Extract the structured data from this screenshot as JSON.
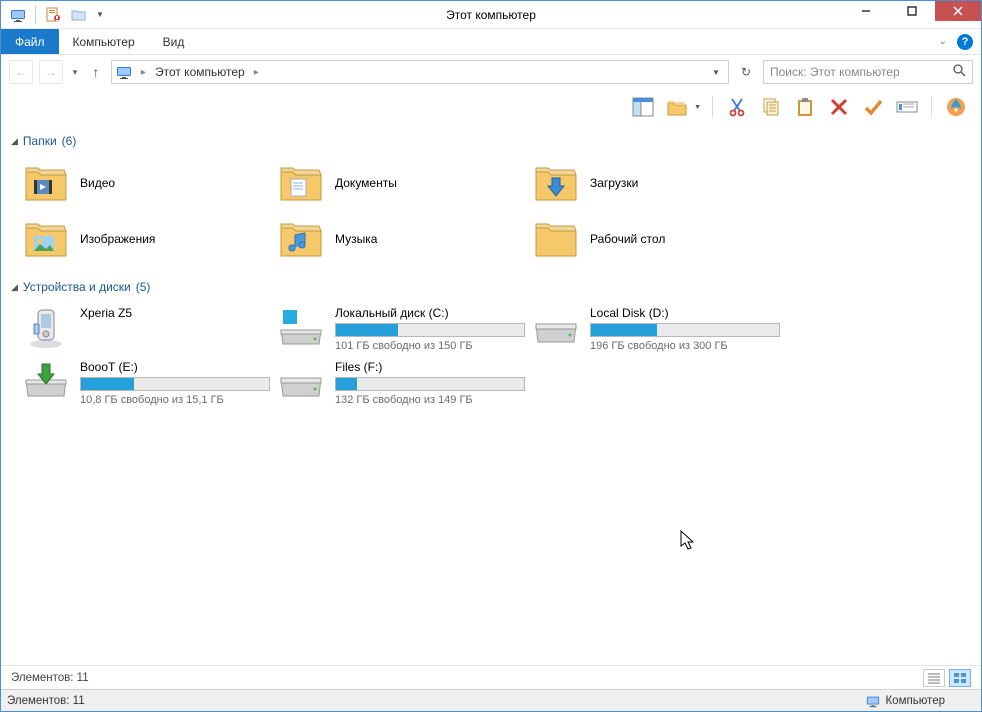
{
  "window": {
    "title": "Этот компьютер"
  },
  "menu": {
    "file": "Файл",
    "computer": "Компьютер",
    "view": "Вид"
  },
  "breadcrumb": {
    "location": "Этот компьютер"
  },
  "search": {
    "placeholder": "Поиск: Этот компьютер"
  },
  "groups": {
    "folders": {
      "title": "Папки",
      "count": "(6)"
    },
    "drives": {
      "title": "Устройства и диски",
      "count": "(5)"
    }
  },
  "folders": [
    {
      "label": "Видео"
    },
    {
      "label": "Документы"
    },
    {
      "label": "Загрузки"
    },
    {
      "label": "Изображения"
    },
    {
      "label": "Музыка"
    },
    {
      "label": "Рабочий стол"
    }
  ],
  "devices": [
    {
      "label": "Xperia Z5",
      "type": "device"
    }
  ],
  "drives": [
    {
      "label": "Локальный диск (C:)",
      "free": "101 ГБ свободно из 150 ГБ",
      "used_pct": 33,
      "os": true
    },
    {
      "label": "Local Disk (D:)",
      "free": "196 ГБ свободно из 300 ГБ",
      "used_pct": 35
    },
    {
      "label": "BoooT (E:)",
      "free": "10,8 ГБ свободно из 15,1 ГБ",
      "used_pct": 28,
      "boot": true
    },
    {
      "label": "Files (F:)",
      "free": "132 ГБ свободно из 149 ГБ",
      "used_pct": 11
    }
  ],
  "status": {
    "line1": "Элементов: 11",
    "line2": "Элементов: 11",
    "computer": "Компьютер"
  }
}
